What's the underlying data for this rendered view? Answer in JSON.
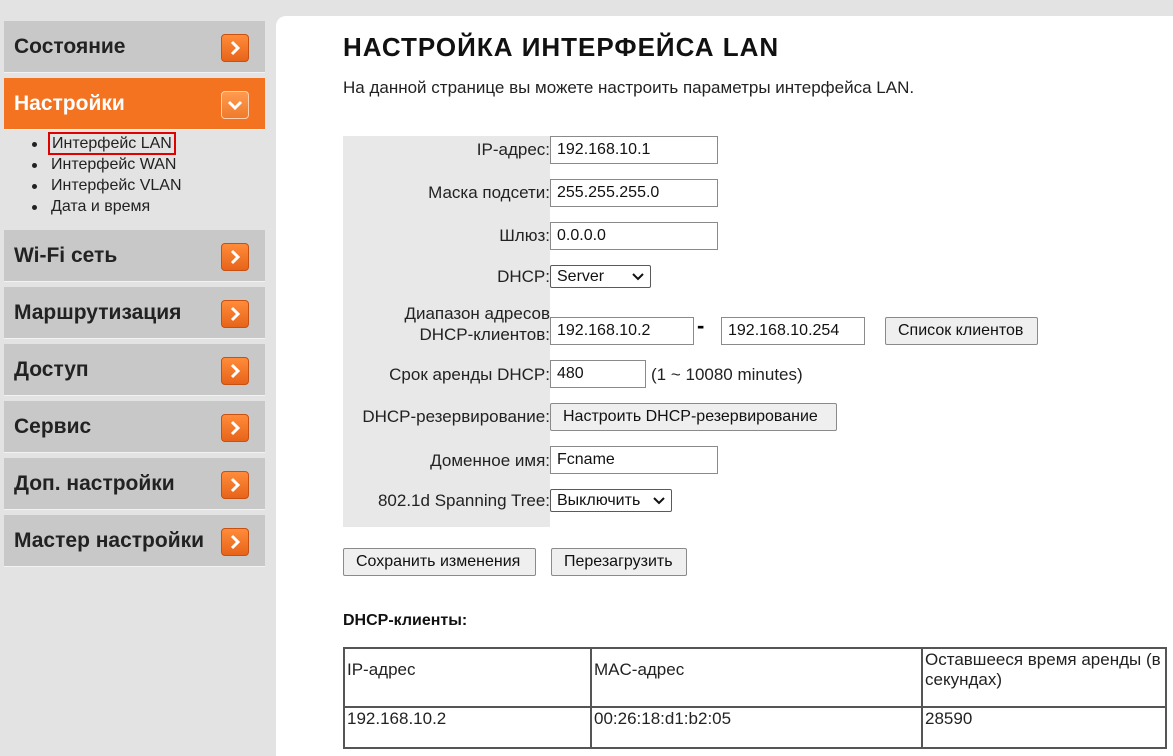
{
  "sidebar": {
    "items": [
      {
        "label": "Состояние",
        "active": false
      },
      {
        "label": "Настройки",
        "active": true
      },
      {
        "label": "Wi-Fi сеть",
        "active": false
      },
      {
        "label": "Маршрутизация",
        "active": false
      },
      {
        "label": "Доступ",
        "active": false
      },
      {
        "label": "Сервис",
        "active": false
      },
      {
        "label": "Доп. настройки",
        "active": false
      },
      {
        "label": "Мастер настройки",
        "active": false
      }
    ],
    "submenu": [
      {
        "label": "Интерфейс LAN",
        "selected": true
      },
      {
        "label": "Интерфейс WAN",
        "selected": false
      },
      {
        "label": "Интерфейс VLAN",
        "selected": false
      },
      {
        "label": "Дата и время",
        "selected": false
      }
    ],
    "arrow_icon": "chevron-right-icon",
    "arrow_icon_active": "chevron-down-icon",
    "accent_color": "#f37320"
  },
  "main": {
    "title": "НАСТРОЙКА ИНТЕРФЕЙСА LAN",
    "description": "На данной странице вы можете настроить параметры интерфейса LAN.",
    "form": {
      "ip_label": "IP-адрес:",
      "ip_value": "192.168.10.1",
      "mask_label": "Маска подсети:",
      "mask_value": "255.255.255.0",
      "gateway_label": "Шлюз:",
      "gateway_value": "0.0.0.0",
      "dhcp_label": "DHCP:",
      "dhcp_value": "Server",
      "range_label_line1": "Диапазон адресов",
      "range_label_line2": "DHCP-клиентов:",
      "range_start": "192.168.10.2",
      "range_separator": "-",
      "range_end": "192.168.10.254",
      "clients_list_button": "Список клиентов",
      "lease_label": "Срок аренды DHCP:",
      "lease_value": "480",
      "lease_hint": "(1 ~ 10080 minutes)",
      "reservation_label": "DHCP-резервирование:",
      "reservation_button": "Настроить DHCP-резервирование",
      "domain_label": "Доменное имя:",
      "domain_value": "Fcname",
      "stp_label": "802.1d Spanning Tree:",
      "stp_value": "Выключить"
    },
    "buttons": {
      "save": "Сохранить изменения",
      "reboot": "Перезагрузить"
    },
    "clients": {
      "title": "DHCP-клиенты:",
      "columns": [
        "IP-адрес",
        "MAC-адрес",
        "Оставшееся время аренды (в секундах)"
      ],
      "rows": [
        [
          "192.168.10.2",
          "00:26:18:d1:b2:05",
          "28590"
        ]
      ]
    }
  }
}
